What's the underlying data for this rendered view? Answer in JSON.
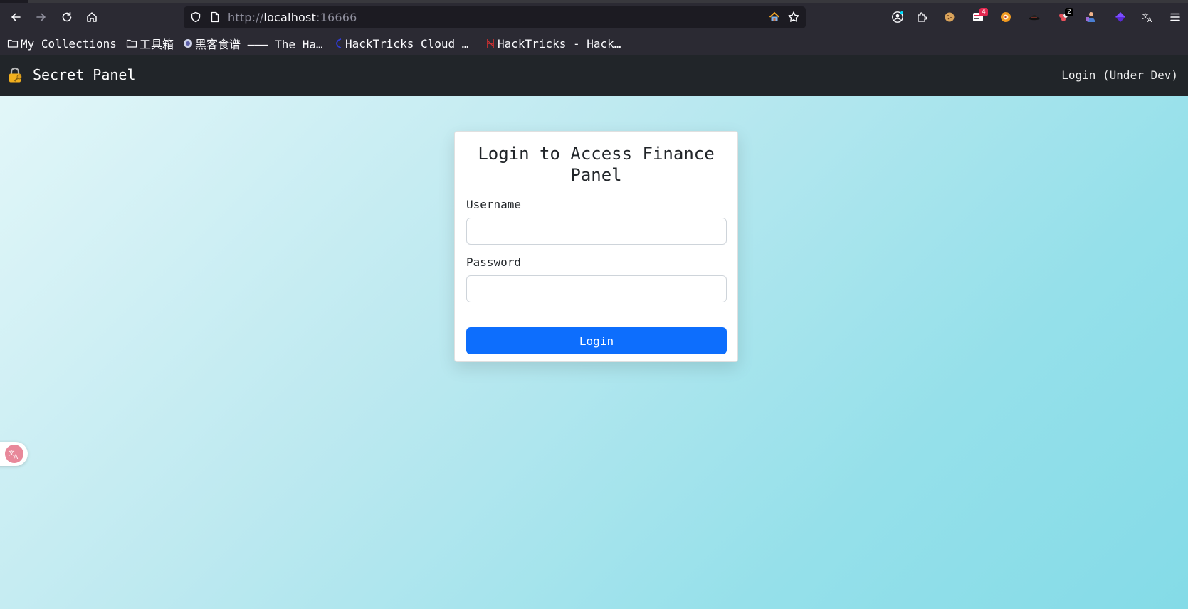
{
  "browser": {
    "url_scheme": "http://",
    "url_host": "localhost",
    "url_port": ":16666",
    "extensions": [
      {
        "name": "account-icon",
        "badge": ""
      },
      {
        "name": "extensions-icon",
        "badge": ""
      },
      {
        "name": "cookie-icon",
        "badge": ""
      },
      {
        "name": "ext-red-icon",
        "badge": "4"
      },
      {
        "name": "ext-orange-icon",
        "badge": ""
      },
      {
        "name": "ext-hat-icon",
        "badge": ""
      },
      {
        "name": "ext-dots-icon",
        "badge": "2"
      },
      {
        "name": "ext-person-icon",
        "badge": ""
      },
      {
        "name": "ext-cube-icon",
        "badge": ""
      },
      {
        "name": "translate-icon",
        "badge": ""
      },
      {
        "name": "menu-icon",
        "badge": ""
      }
    ],
    "bookmarks": [
      {
        "label": "My Collections",
        "icon": "folder-icon"
      },
      {
        "label": "工具箱",
        "icon": "folder-icon"
      },
      {
        "label": "黑客食谱 ——— The Ha…",
        "icon": "site-icon"
      },
      {
        "label": "HackTricks Cloud …",
        "icon": "site-icon"
      },
      {
        "label": "HackTricks - Hack…",
        "icon": "site-icon"
      }
    ]
  },
  "navbar": {
    "brand": "Secret Panel",
    "link": "Login (Under Dev)"
  },
  "login": {
    "title": "Login to Access Finance Panel",
    "username_label": "Username",
    "username_value": "",
    "password_label": "Password",
    "password_value": "",
    "submit_label": "Login"
  },
  "colors": {
    "navbar_bg": "#212529",
    "primary": "#0d6efd",
    "page_gradient_start": "#e4f7f9",
    "page_gradient_end": "#84dbe7"
  },
  "float_widget": {
    "icon": "translate-widget-icon"
  }
}
